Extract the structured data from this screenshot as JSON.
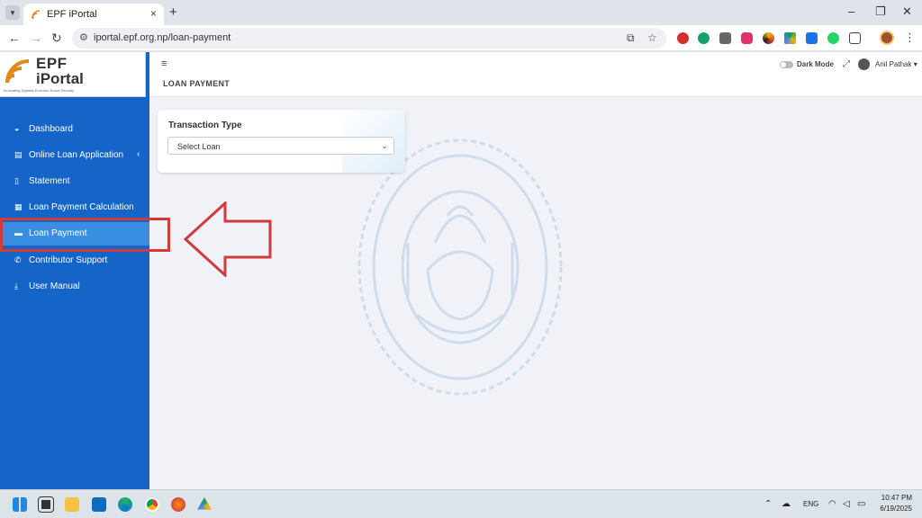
{
  "browser": {
    "tab_title": "EPF iPortal",
    "tab_close": "×",
    "new_tab": "+",
    "url": "iportal.epf.org.np/loan-payment",
    "window_controls": {
      "minimize": "–",
      "restore": "❐",
      "close": "✕"
    },
    "extension_icons": [
      "ublock-icon",
      "grammarly-icon",
      "gear-icon",
      "instagram-icon",
      "palette-icon",
      "drive-icon",
      "meet-icon",
      "whatsapp-icon",
      "extensions-icon"
    ]
  },
  "brand": {
    "line1": "EPF",
    "line2": "iPortal",
    "tagline": "Innovating Digitally Enriched Social Security"
  },
  "sidebar": {
    "items": [
      {
        "label": "Dashboard",
        "icon": "dashboard-icon"
      },
      {
        "label": "Online Loan Application",
        "icon": "document-icon",
        "caret": "‹"
      },
      {
        "label": "Statement",
        "icon": "file-icon"
      },
      {
        "label": "Loan Payment Calculation",
        "icon": "calculator-icon"
      },
      {
        "label": "Loan Payment",
        "icon": "credit-card-icon",
        "active": true
      },
      {
        "label": "Contributor Support",
        "icon": "phone-icon"
      },
      {
        "label": "User Manual",
        "icon": "download-icon"
      }
    ]
  },
  "topbar": {
    "menu_toggle": "≡",
    "page_title": "LOAN PAYMENT",
    "dark_mode_label": "Dark Mode",
    "user_name": "Anil Pathak ▾"
  },
  "form": {
    "title": "Transaction Type",
    "select_value": "Select Loan"
  },
  "taskbar": {
    "language": "ENG",
    "time": "10:47 PM",
    "date": "6/19/2025"
  },
  "colors": {
    "sidebar": "#1565c8",
    "sidebar_active": "#3a8ee2",
    "annotation": "#d03b3b",
    "page_bg": "#f1f2f7"
  }
}
